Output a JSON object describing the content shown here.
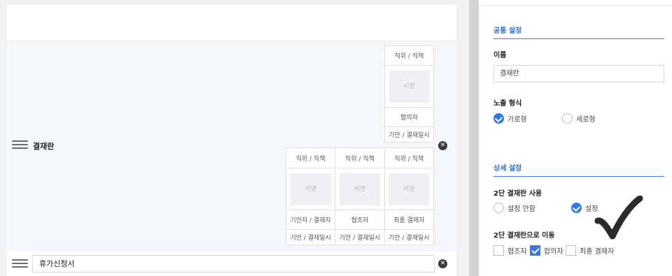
{
  "canvas": {
    "approval_block": {
      "label": "결재란",
      "top_table": {
        "position": "직위 / 직책",
        "signature": "서명",
        "role": "합의자",
        "date": "기안 / 결재일시"
      },
      "bottom_table": {
        "columns": [
          {
            "position": "직위 / 직책",
            "signature": "서명",
            "role": "기안자 / 결재자",
            "date": "기안 / 결재일시"
          },
          {
            "position": "직위 / 직책",
            "signature": "서명",
            "role": "협조자",
            "date": "기안 / 결재일시"
          },
          {
            "position": "직위 / 직책",
            "signature": "서명",
            "role": "최종 결재자",
            "date": "기안 / 결재일시"
          }
        ]
      }
    },
    "title_field": {
      "value": "휴가신청서"
    }
  },
  "panel": {
    "common_section": {
      "title": "공통 설정",
      "name_label": "이름",
      "name_value": "결재란",
      "display_label": "노출 형식",
      "display_options": [
        {
          "label": "가로형",
          "selected": true
        },
        {
          "label": "세로형",
          "selected": false
        }
      ]
    },
    "detail_section": {
      "title": "상세 설정",
      "two_stage_label": "2단 결재란 사용",
      "two_stage_options": [
        {
          "label": "설정 안함",
          "selected": false
        },
        {
          "label": "설정",
          "selected": true
        }
      ],
      "move_label": "2단 결재란으로 이동",
      "move_options": [
        {
          "label": "협조자",
          "checked": false
        },
        {
          "label": "합의자",
          "checked": true
        },
        {
          "label": "최종 결재자",
          "checked": false
        }
      ]
    }
  },
  "colors": {
    "accent": "#2f7ae5",
    "block_bg": "#f3f7fc",
    "gutter": "#d3d3d3"
  },
  "icons": {
    "handle": "drag-handle-icon",
    "remove": "close-circle-icon",
    "annotation": "checkmark-annotation-icon"
  }
}
